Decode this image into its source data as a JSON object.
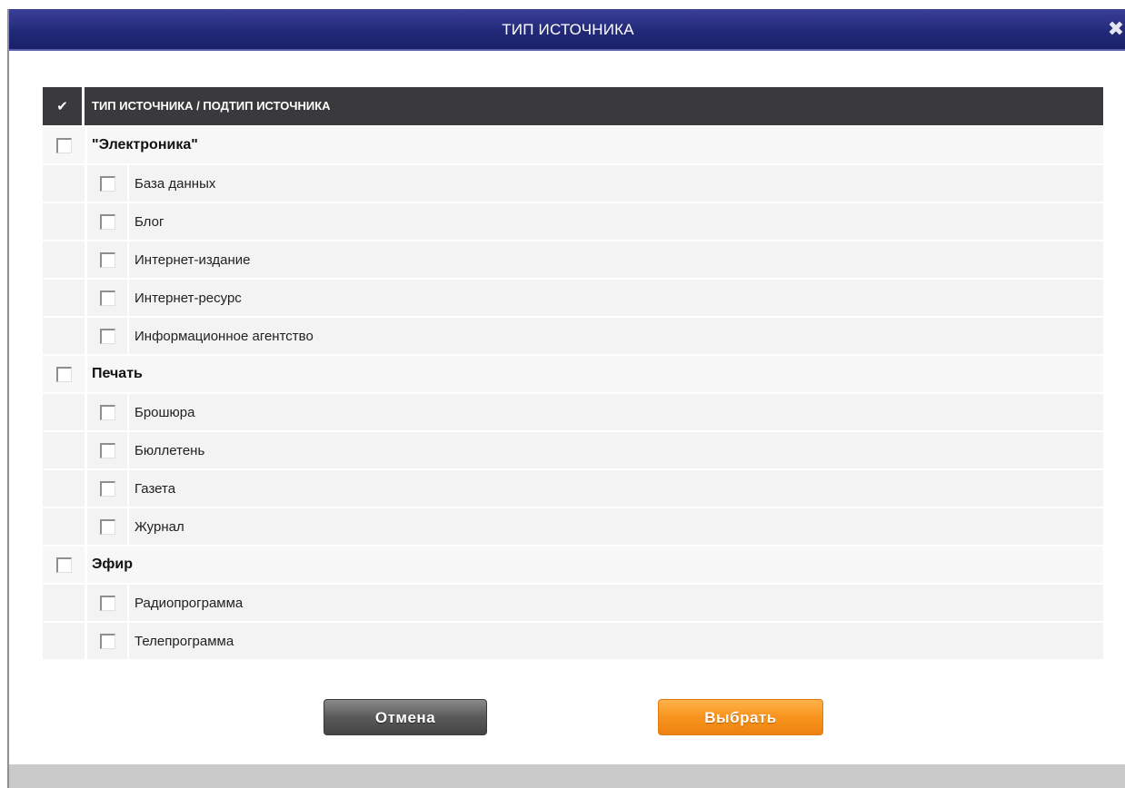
{
  "dialog": {
    "title": "ТИП ИСТОЧНИКА",
    "close_glyph": "✖"
  },
  "table": {
    "header_check_glyph": "✔",
    "header_label": "ТИП ИСТОЧНИКА / ПОДТИП ИСТОЧНИКА",
    "groups": [
      {
        "label": "\"Электроника\"",
        "checked": false,
        "items": [
          {
            "label": "База данных",
            "checked": false
          },
          {
            "label": "Блог",
            "checked": false
          },
          {
            "label": "Интернет-издание",
            "checked": false
          },
          {
            "label": "Интернет-ресурс",
            "checked": false
          },
          {
            "label": "Информационное агентство",
            "checked": false
          }
        ]
      },
      {
        "label": "Печать",
        "checked": false,
        "items": [
          {
            "label": "Брошюра",
            "checked": false
          },
          {
            "label": "Бюллетень",
            "checked": false
          },
          {
            "label": "Газета",
            "checked": false
          },
          {
            "label": "Журнал",
            "checked": false
          }
        ]
      },
      {
        "label": "Эфир",
        "checked": false,
        "items": [
          {
            "label": "Радиопрограмма",
            "checked": false
          },
          {
            "label": "Телепрограмма",
            "checked": false
          }
        ]
      }
    ]
  },
  "buttons": {
    "cancel_label": "Отмена",
    "select_label": "Выбрать"
  },
  "colors": {
    "titlebar": "#222a78",
    "header": "#3a3a3c",
    "row_bg": "#f3f3f3",
    "cancel_button": "#5a5a5a",
    "select_button": "#f7941d"
  }
}
